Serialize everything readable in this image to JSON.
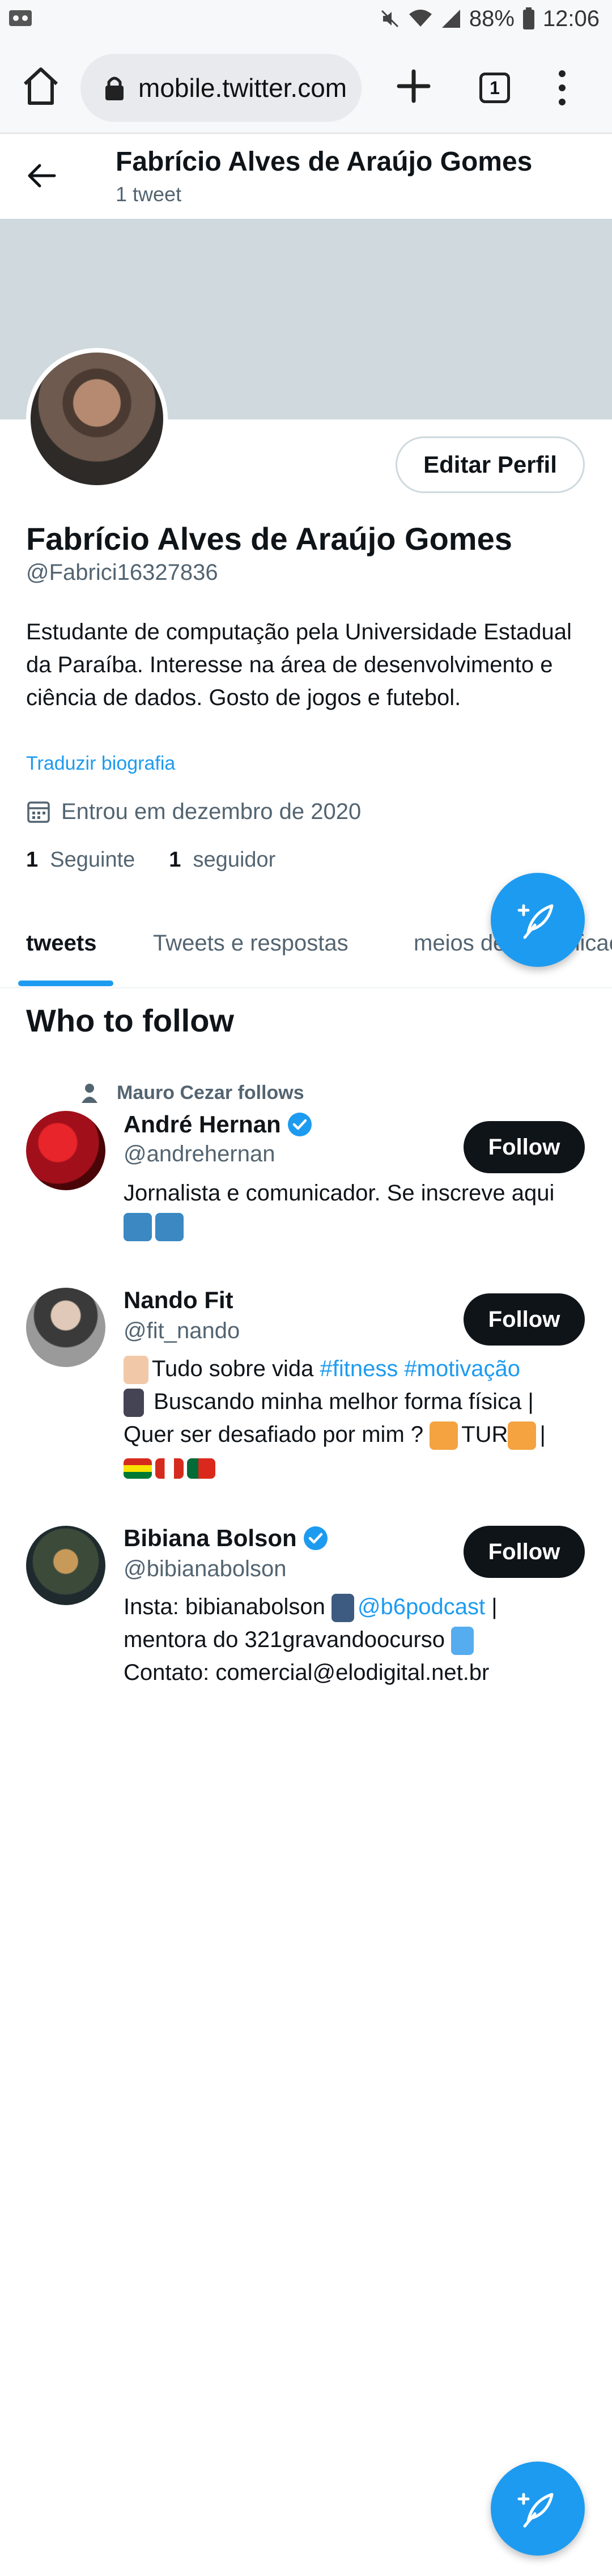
{
  "status_bar": {
    "battery": "88%",
    "time": "12:06"
  },
  "browser": {
    "url": "mobile.twitter.com",
    "tab_count": "1"
  },
  "header": {
    "name": "Fabrício Alves de Araújo Gomes",
    "tweet_count": "1 tweet"
  },
  "profile": {
    "edit_label": "Editar Perfil",
    "name": "Fabrício Alves de Araújo Gomes",
    "handle": "@Fabrici16327836",
    "bio": "Estudante de computação pela Universidade Estadual da Paraíba. Interesse na área de desenvolvimento e ciência de dados. Gosto de jogos e futebol.",
    "translate": "Traduzir biografia",
    "joined": "Entrou em dezembro de 2020",
    "following_count": "1",
    "following_label": "Seguinte",
    "followers_count": "1",
    "followers_label": "seguidor"
  },
  "tabs": [
    "tweets",
    "Tweets e respostas",
    "meios de comunicação"
  ],
  "who_to_follow": {
    "title": "Who to follow",
    "follow_label": "Follow",
    "suggestions": [
      {
        "context": "Mauro Cezar follows",
        "name": "André Hernan",
        "verified": true,
        "handle": "@andrehernan",
        "bio": "Jornalista e comunicador. Se inscreve aqui"
      },
      {
        "name": "Nando Fit",
        "verified": false,
        "handle": "@fit_nando",
        "bio_line1_text": "Tudo sobre vida ",
        "bio_line1_tags": "#fitness #motivação",
        "bio_line2": " Buscando minha melhor forma física |",
        "bio_line3": "Quer ser desafiado por mim ? ",
        "bio_line3_mid": "TUR",
        "bio_line3_end": "|"
      },
      {
        "name": "Bibiana Bolson",
        "verified": true,
        "handle": "@bibianabolson",
        "bio_line1_text": "Insta: bibianabolson ",
        "bio_line1_link": "@b6podcast",
        "bio_line1_end": " |",
        "bio_line2": "mentora do 321gravandoocurso ",
        "bio_line3": "Contato: comercial@elodigital.net.br"
      }
    ]
  },
  "colors": {
    "accent": "#1d9bf0",
    "banner": "#cfd9de",
    "text": "#0f1419",
    "muted": "#536471"
  },
  "icons": [
    "home-icon",
    "lock-icon",
    "plus-icon",
    "tabs-icon",
    "menu-icon",
    "back-arrow-icon",
    "calendar-icon",
    "verified-icon",
    "compose-tweet-icon",
    "person-icon"
  ]
}
